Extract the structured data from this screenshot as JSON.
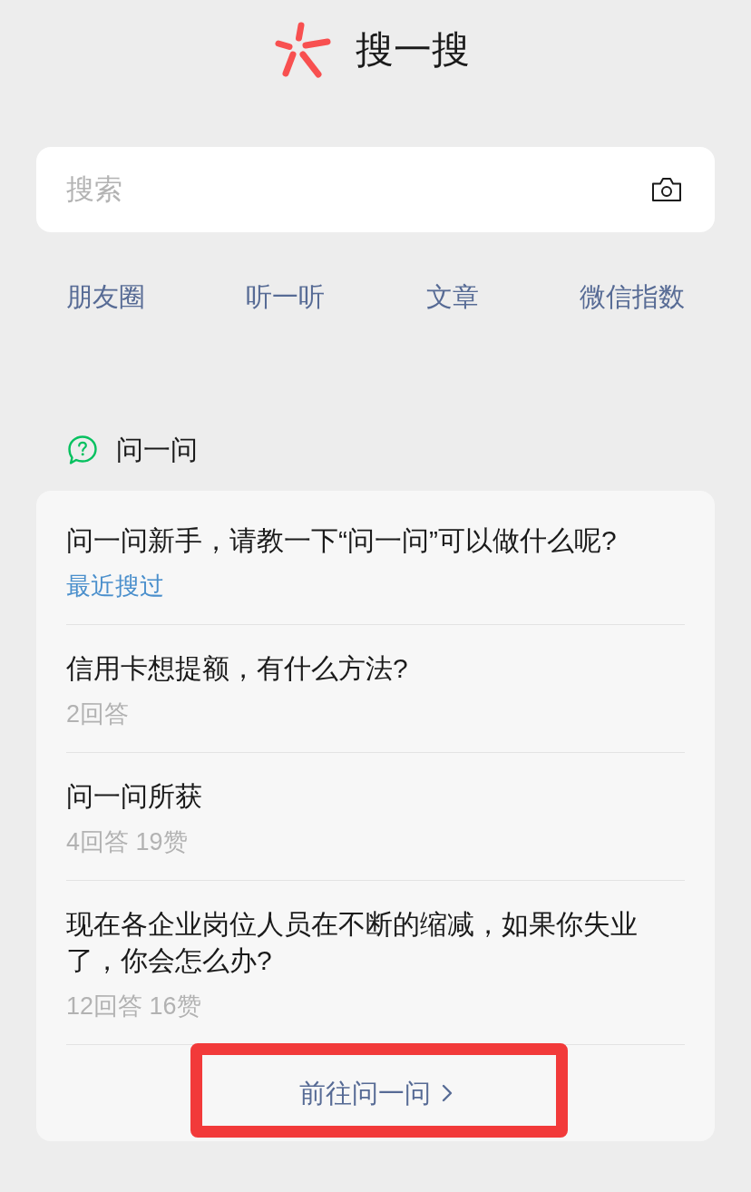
{
  "header": {
    "title": "搜一搜"
  },
  "search": {
    "placeholder": "搜索"
  },
  "categories": [
    "朋友圈",
    "听一听",
    "文章",
    "微信指数"
  ],
  "section": {
    "title": "问一问"
  },
  "questions": [
    {
      "title": "问一问新手，请教一下“问一问”可以做什么呢?",
      "note": "最近搜过",
      "kind": "recent"
    },
    {
      "title": "信用卡想提额，有什么方法?",
      "note": "2回答",
      "kind": "stats"
    },
    {
      "title": "问一问所获",
      "note": "4回答 19赞",
      "kind": "stats"
    },
    {
      "title": "现在各企业岗位人员在不断的缩减，如果你失业了，你会怎么办?",
      "note": "12回答 16赞",
      "kind": "stats"
    }
  ],
  "more_link": {
    "label": "前往问一问",
    "highlighted": true
  }
}
